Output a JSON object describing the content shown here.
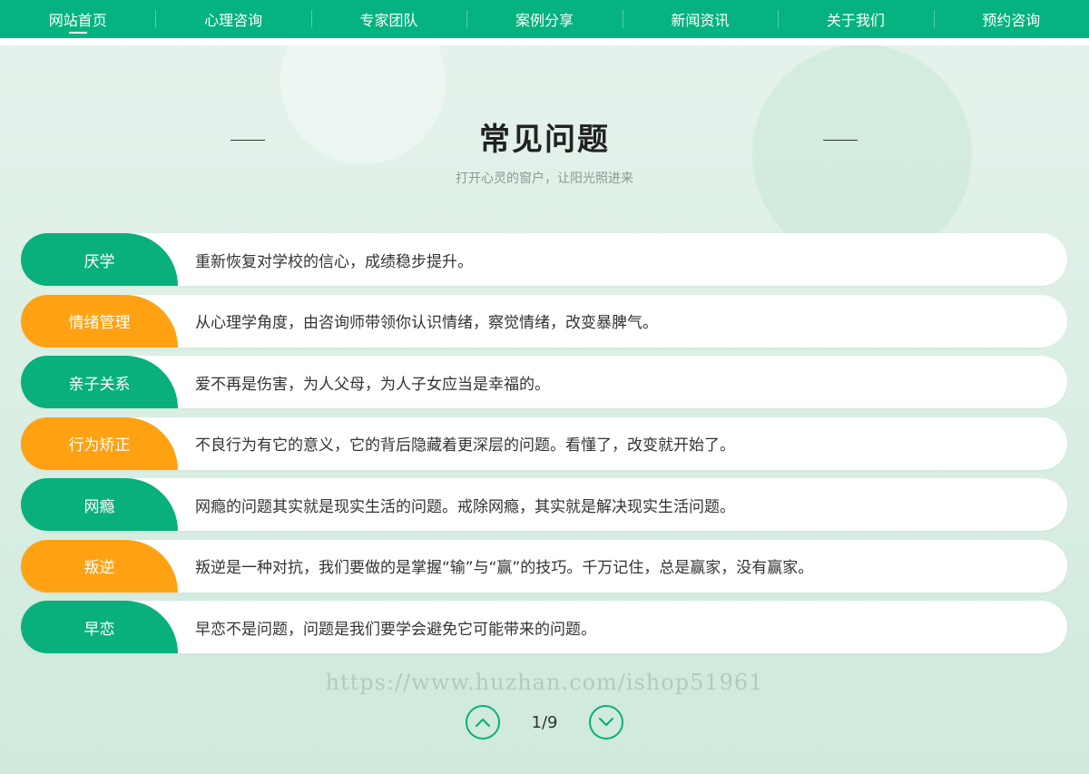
{
  "nav": {
    "items": [
      {
        "label": "网站首页",
        "active": true
      },
      {
        "label": "心理咨询"
      },
      {
        "label": "专家团队"
      },
      {
        "label": "案例分享"
      },
      {
        "label": "新闻资讯"
      },
      {
        "label": "关于我们"
      },
      {
        "label": "预约咨询"
      }
    ]
  },
  "section": {
    "title": "常见问题",
    "subtitle": "打开心灵的窗户，让阳光照进来"
  },
  "faq": [
    {
      "tag": "厌学",
      "text": "重新恢复对学校的信心，成绩稳步提升。",
      "color": "green"
    },
    {
      "tag": "情绪管理",
      "text": "从心理学角度，由咨询师带领你认识情绪，察觉情绪，改变暴脾气。",
      "color": "orange"
    },
    {
      "tag": "亲子关系",
      "text": "爱不再是伤害，为人父母，为人子女应当是幸福的。",
      "color": "green"
    },
    {
      "tag": "行为矫正",
      "text": "不良行为有它的意义，它的背后隐藏着更深层的问题。看懂了，改变就开始了。",
      "color": "orange"
    },
    {
      "tag": "网瘾",
      "text": "网瘾的问题其实就是现实生活的问题。戒除网瘾，其实就是解决现实生活问题。",
      "color": "green"
    },
    {
      "tag": "叛逆",
      "text": "叛逆是一种对抗，我们要做的是掌握“输”与“赢”的技巧。千万记住，总是赢家，没有赢家。",
      "color": "orange"
    },
    {
      "tag": "早恋",
      "text": "早恋不是问题，问题是我们要学会避免它可能带来的问题。",
      "color": "green"
    }
  ],
  "watermark": "https://www.huzhan.com/ishop51961",
  "pager": {
    "current": "1/9",
    "prev_icon": "chevron-up-icon",
    "next_icon": "chevron-down-icon"
  },
  "colors": {
    "brand_green": "#04b37f",
    "tag_green": "#09b07c",
    "tag_orange": "#fea214"
  }
}
